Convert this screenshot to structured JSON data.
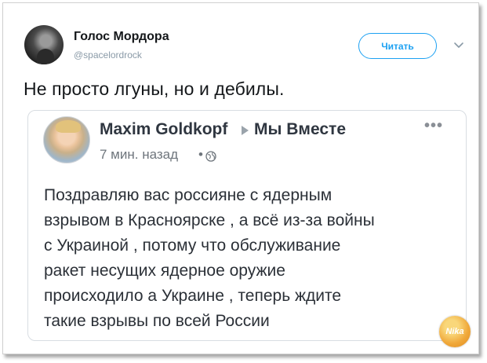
{
  "tweet": {
    "display_name": "Голос Мордора",
    "handle": "@spacelordrock",
    "follow_label": "Читать",
    "text": "Не просто лгуны, но и дебилы."
  },
  "quoted_post": {
    "author": "Maxim Goldkopf",
    "group": "Мы Вместе",
    "more_label": "•••",
    "time": "7 мин. назад",
    "separator": "•",
    "body_lines": [
      "Поздравляю вас россияне с ядерным",
      "взрывом в Красноярске , а всё из-за войны",
      "с Украиной , потому что обслуживание",
      "ракет несущих ядерное оружие",
      "происходило а Украине , теперь ждите",
      "такие взрывы по всей России"
    ]
  },
  "watermark": {
    "text": "Nika"
  },
  "colors": {
    "accent": "#1da1f2",
    "text": "#14171a",
    "muted": "#8a9aa7"
  },
  "icons": {
    "chevron": "chevron-down-icon",
    "globe": "globe-icon",
    "arrow": "arrow-right-icon"
  }
}
